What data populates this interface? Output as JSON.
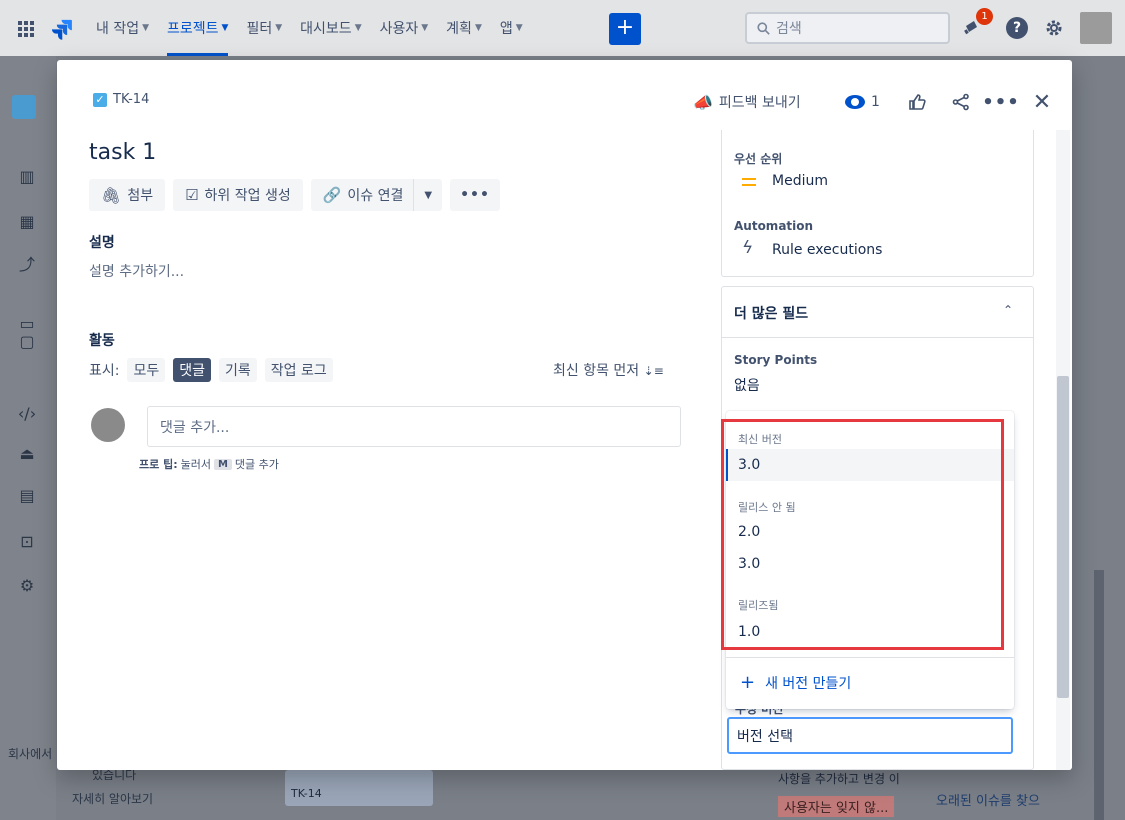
{
  "topnav": {
    "items": [
      {
        "label": "내 작업"
      },
      {
        "label": "프로젝트"
      },
      {
        "label": "필터"
      },
      {
        "label": "대시보드"
      },
      {
        "label": "사용자"
      },
      {
        "label": "계획"
      },
      {
        "label": "앱"
      }
    ],
    "create_label": "+",
    "search_placeholder": "검색",
    "notification_count": "1",
    "help_label": "?"
  },
  "sidebar": {
    "footer_text": "회사에서",
    "icons": [
      "board-icon",
      "backlog-icon",
      "reports-icon",
      "releases-icon",
      "components-icon",
      "code-icon",
      "deployments-icon",
      "pages-icon",
      "add-shortcut-icon",
      "settings-icon"
    ]
  },
  "background": {
    "learn_more": "자세히 알아보기",
    "learn_partial": "있습니다",
    "card_key": "TK-14",
    "right_text_1": "사항을 추가하고 변경 이",
    "right_text_2": "사용자는 잊지 않...",
    "right_text_3": "오래된 이슈를 찾으"
  },
  "issue": {
    "key": "TK-14",
    "title": "task 1",
    "actions": {
      "attach": "첨부",
      "subtask": "하위 작업 생성",
      "link": "이슈 연결"
    },
    "description_label": "설명",
    "description_placeholder": "설명 추가하기...",
    "activity_label": "활동",
    "show_label": "표시:",
    "show_options": [
      "모두",
      "댓글",
      "기록",
      "작업 로그"
    ],
    "active_show_option": "댓글",
    "sort_label": "최신 항목 먼저",
    "comment_placeholder": "댓글 추가...",
    "pro_tip": {
      "prefix": "프로 팁:",
      "middle": "눌러서",
      "key": "M",
      "suffix": "댓글 추가"
    }
  },
  "header": {
    "feedback_label": "피드백 보내기",
    "watch_count": "1"
  },
  "details": {
    "priority_label": "우선 순위",
    "priority_value": "Medium",
    "automation_label": "Automation",
    "automation_value": "Rule executions",
    "more_fields_label": "더 많은 필드",
    "story_points_label": "Story Points",
    "story_points_value": "없음",
    "fix_version_label": "수정 버전",
    "fix_version_input": "버전 선택"
  },
  "dropdown": {
    "groups": [
      {
        "label": "최신 버전",
        "options": [
          "3.0"
        ]
      },
      {
        "label": "릴리스 안 됨",
        "options": [
          "2.0",
          "3.0"
        ]
      },
      {
        "label": "릴리즈됨",
        "options": [
          "1.0"
        ]
      }
    ],
    "create_label": "새 버전 만들기"
  },
  "colors": {
    "accent": "#0052cc",
    "highlight_border": "#e5393f",
    "priority_medium": "#ffab00"
  }
}
